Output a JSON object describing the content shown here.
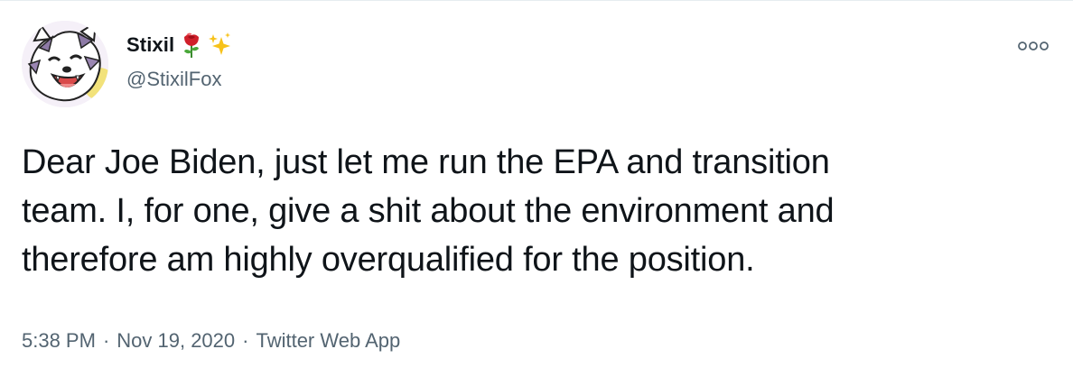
{
  "tweet": {
    "author": {
      "display_name": "Stixil",
      "handle": "@StixilFox",
      "name_emojis": [
        "rose-emoji",
        "sparkles-emoji"
      ],
      "avatar_icon": "fox-avatar"
    },
    "text": "Dear Joe Biden, just let me run the EPA and transition\nteam. I, for one, give a shit about the environment and\ntherefore am highly overqualified for the position.",
    "time": "5:38 PM",
    "separator": "·",
    "date": "Nov 19, 2020",
    "source": "Twitter Web App",
    "more_icon": "more-options-icon"
  },
  "colors": {
    "text_primary": "#0f1419",
    "text_secondary": "#536471",
    "divider": "#e6ecf0"
  }
}
